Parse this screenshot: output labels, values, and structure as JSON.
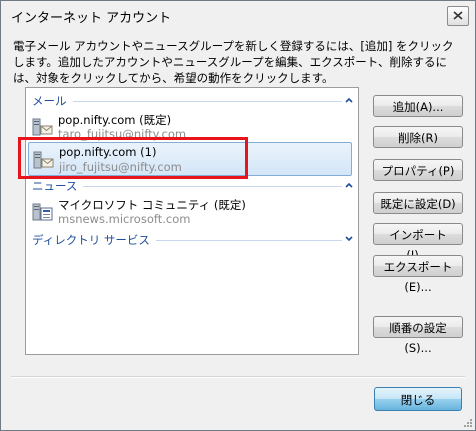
{
  "window": {
    "title": "インターネット アカウント",
    "close_icon": "close-icon"
  },
  "description": "電子メール アカウントやニュースグループを新しく登録するには、[追加] をクリックします。追加したアカウントやニュースグループを編集、エクスポート、削除するには、対象をクリックしてから、希望の動作をクリックします。",
  "list": {
    "groups": [
      {
        "label": "メール",
        "state": "expanded"
      },
      {
        "label": "ニュース",
        "state": "expanded"
      },
      {
        "label": "ディレクトリ サービス",
        "state": "collapsed"
      }
    ],
    "mail_items": [
      {
        "name": "pop.nifty.com (既定)",
        "sub": "taro_fujitsu@nifty.com",
        "icon": "mail-server-icon"
      },
      {
        "name": "pop.nifty.com (1)",
        "sub": "jiro_fujitsu@nifty.com",
        "icon": "mail-server-icon",
        "selected": true
      }
    ],
    "news_items": [
      {
        "name": "マイクロソフト コミュニティ (既定)",
        "sub": "msnews.microsoft.com",
        "icon": "news-server-icon"
      }
    ]
  },
  "buttons": {
    "add": "追加(A)...",
    "remove": "削除(R)",
    "properties": "プロパティ(P)",
    "set_default": "既定に設定(D)",
    "import": "インポート(I)...",
    "export": "エクスポート(E)...",
    "set_order": "順番の設定(S)...",
    "close": "閉じる"
  },
  "colors": {
    "group_header": "#1f4e9c",
    "highlight_frame": "#e8141c",
    "selection": "#d4e6f8"
  }
}
